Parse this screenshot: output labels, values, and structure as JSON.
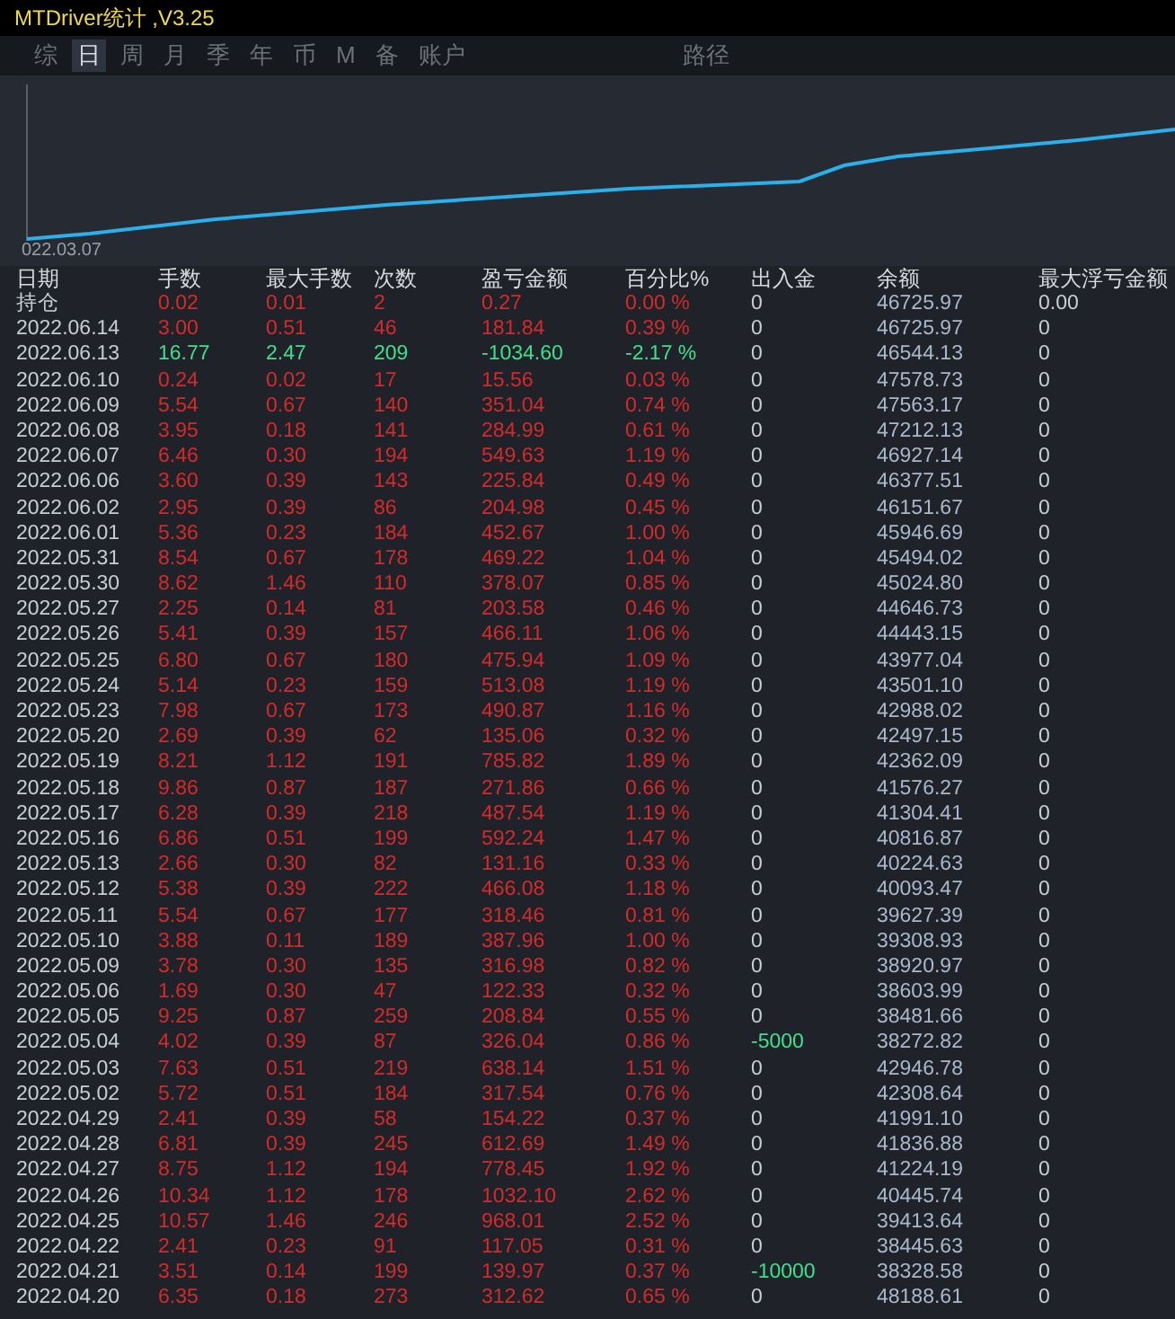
{
  "window": {
    "title": "MTDriver统计 ,V3.25"
  },
  "tabs": [
    {
      "label": "综",
      "selected": false
    },
    {
      "label": "日",
      "selected": true
    },
    {
      "label": "周",
      "selected": false
    },
    {
      "label": "月",
      "selected": false
    },
    {
      "label": "季",
      "selected": false
    },
    {
      "label": "年",
      "selected": false
    },
    {
      "label": "币",
      "selected": false
    },
    {
      "label": "M",
      "selected": false
    },
    {
      "label": "备",
      "selected": false
    },
    {
      "label": "账户",
      "selected": false
    }
  ],
  "path_tab": {
    "label": "路径",
    "selected": false
  },
  "chart": {
    "start_label": "022.03.07"
  },
  "table": {
    "columns": [
      "日期",
      "手数",
      "最大手数",
      "次数",
      "盈亏金额",
      "百分比%",
      "出入金",
      "余额",
      "最大浮亏金额"
    ],
    "rows": [
      {
        "cells": [
          "持仓",
          "0.02",
          "0.01",
          "2",
          "0.27",
          "0.00 %",
          "0",
          "46725.97",
          "0.00"
        ],
        "loss": false,
        "deposit_highlight": false
      },
      {
        "cells": [
          "2022.06.14",
          "3.00",
          "0.51",
          "46",
          "181.84",
          "0.39 %",
          "0",
          "46725.97",
          "0"
        ],
        "loss": false,
        "deposit_highlight": false
      },
      {
        "cells": [
          "2022.06.13",
          "16.77",
          "2.47",
          "209",
          "-1034.60",
          "-2.17 %",
          "0",
          "46544.13",
          "0"
        ],
        "loss": true,
        "deposit_highlight": false
      },
      {
        "cells": [
          "2022.06.10",
          "0.24",
          "0.02",
          "17",
          "15.56",
          "0.03 %",
          "0",
          "47578.73",
          "0"
        ],
        "loss": false,
        "deposit_highlight": false
      },
      {
        "cells": [
          "2022.06.09",
          "5.54",
          "0.67",
          "140",
          "351.04",
          "0.74 %",
          "0",
          "47563.17",
          "0"
        ],
        "loss": false,
        "deposit_highlight": false
      },
      {
        "cells": [
          "2022.06.08",
          "3.95",
          "0.18",
          "141",
          "284.99",
          "0.61 %",
          "0",
          "47212.13",
          "0"
        ],
        "loss": false,
        "deposit_highlight": false
      },
      {
        "cells": [
          "2022.06.07",
          "6.46",
          "0.30",
          "194",
          "549.63",
          "1.19 %",
          "0",
          "46927.14",
          "0"
        ],
        "loss": false,
        "deposit_highlight": false
      },
      {
        "cells": [
          "2022.06.06",
          "3.60",
          "0.39",
          "143",
          "225.84",
          "0.49 %",
          "0",
          "46377.51",
          "0"
        ],
        "loss": false,
        "deposit_highlight": false
      },
      {
        "cells": [
          "2022.06.02",
          "2.95",
          "0.39",
          "86",
          "204.98",
          "0.45 %",
          "0",
          "46151.67",
          "0"
        ],
        "loss": false,
        "deposit_highlight": false
      },
      {
        "cells": [
          "2022.06.01",
          "5.36",
          "0.23",
          "184",
          "452.67",
          "1.00 %",
          "0",
          "45946.69",
          "0"
        ],
        "loss": false,
        "deposit_highlight": false
      },
      {
        "cells": [
          "2022.05.31",
          "8.54",
          "0.67",
          "178",
          "469.22",
          "1.04 %",
          "0",
          "45494.02",
          "0"
        ],
        "loss": false,
        "deposit_highlight": false
      },
      {
        "cells": [
          "2022.05.30",
          "8.62",
          "1.46",
          "110",
          "378.07",
          "0.85 %",
          "0",
          "45024.80",
          "0"
        ],
        "loss": false,
        "deposit_highlight": false
      },
      {
        "cells": [
          "2022.05.27",
          "2.25",
          "0.14",
          "81",
          "203.58",
          "0.46 %",
          "0",
          "44646.73",
          "0"
        ],
        "loss": false,
        "deposit_highlight": false
      },
      {
        "cells": [
          "2022.05.26",
          "5.41",
          "0.39",
          "157",
          "466.11",
          "1.06 %",
          "0",
          "44443.15",
          "0"
        ],
        "loss": false,
        "deposit_highlight": false
      },
      {
        "cells": [
          "2022.05.25",
          "6.80",
          "0.67",
          "180",
          "475.94",
          "1.09 %",
          "0",
          "43977.04",
          "0"
        ],
        "loss": false,
        "deposit_highlight": false
      },
      {
        "cells": [
          "2022.05.24",
          "5.14",
          "0.23",
          "159",
          "513.08",
          "1.19 %",
          "0",
          "43501.10",
          "0"
        ],
        "loss": false,
        "deposit_highlight": false
      },
      {
        "cells": [
          "2022.05.23",
          "7.98",
          "0.67",
          "173",
          "490.87",
          "1.16 %",
          "0",
          "42988.02",
          "0"
        ],
        "loss": false,
        "deposit_highlight": false
      },
      {
        "cells": [
          "2022.05.20",
          "2.69",
          "0.39",
          "62",
          "135.06",
          "0.32 %",
          "0",
          "42497.15",
          "0"
        ],
        "loss": false,
        "deposit_highlight": false
      },
      {
        "cells": [
          "2022.05.19",
          "8.21",
          "1.12",
          "191",
          "785.82",
          "1.89 %",
          "0",
          "42362.09",
          "0"
        ],
        "loss": false,
        "deposit_highlight": false
      },
      {
        "cells": [
          "2022.05.18",
          "9.86",
          "0.87",
          "187",
          "271.86",
          "0.66 %",
          "0",
          "41576.27",
          "0"
        ],
        "loss": false,
        "deposit_highlight": false
      },
      {
        "cells": [
          "2022.05.17",
          "6.28",
          "0.39",
          "218",
          "487.54",
          "1.19 %",
          "0",
          "41304.41",
          "0"
        ],
        "loss": false,
        "deposit_highlight": false
      },
      {
        "cells": [
          "2022.05.16",
          "6.86",
          "0.51",
          "199",
          "592.24",
          "1.47 %",
          "0",
          "40816.87",
          "0"
        ],
        "loss": false,
        "deposit_highlight": false
      },
      {
        "cells": [
          "2022.05.13",
          "2.66",
          "0.30",
          "82",
          "131.16",
          "0.33 %",
          "0",
          "40224.63",
          "0"
        ],
        "loss": false,
        "deposit_highlight": false
      },
      {
        "cells": [
          "2022.05.12",
          "5.38",
          "0.39",
          "222",
          "466.08",
          "1.18 %",
          "0",
          "40093.47",
          "0"
        ],
        "loss": false,
        "deposit_highlight": false
      },
      {
        "cells": [
          "2022.05.11",
          "5.54",
          "0.67",
          "177",
          "318.46",
          "0.81 %",
          "0",
          "39627.39",
          "0"
        ],
        "loss": false,
        "deposit_highlight": false
      },
      {
        "cells": [
          "2022.05.10",
          "3.88",
          "0.11",
          "189",
          "387.96",
          "1.00 %",
          "0",
          "39308.93",
          "0"
        ],
        "loss": false,
        "deposit_highlight": false
      },
      {
        "cells": [
          "2022.05.09",
          "3.78",
          "0.30",
          "135",
          "316.98",
          "0.82 %",
          "0",
          "38920.97",
          "0"
        ],
        "loss": false,
        "deposit_highlight": false
      },
      {
        "cells": [
          "2022.05.06",
          "1.69",
          "0.30",
          "47",
          "122.33",
          "0.32 %",
          "0",
          "38603.99",
          "0"
        ],
        "loss": false,
        "deposit_highlight": false
      },
      {
        "cells": [
          "2022.05.05",
          "9.25",
          "0.87",
          "259",
          "208.84",
          "0.55 %",
          "0",
          "38481.66",
          "0"
        ],
        "loss": false,
        "deposit_highlight": false
      },
      {
        "cells": [
          "2022.05.04",
          "4.02",
          "0.39",
          "87",
          "326.04",
          "0.86 %",
          "-5000",
          "38272.82",
          "0"
        ],
        "loss": false,
        "deposit_highlight": true
      },
      {
        "cells": [
          "2022.05.03",
          "7.63",
          "0.51",
          "219",
          "638.14",
          "1.51 %",
          "0",
          "42946.78",
          "0"
        ],
        "loss": false,
        "deposit_highlight": false
      },
      {
        "cells": [
          "2022.05.02",
          "5.72",
          "0.51",
          "184",
          "317.54",
          "0.76 %",
          "0",
          "42308.64",
          "0"
        ],
        "loss": false,
        "deposit_highlight": false
      },
      {
        "cells": [
          "2022.04.29",
          "2.41",
          "0.39",
          "58",
          "154.22",
          "0.37 %",
          "0",
          "41991.10",
          "0"
        ],
        "loss": false,
        "deposit_highlight": false
      },
      {
        "cells": [
          "2022.04.28",
          "6.81",
          "0.39",
          "245",
          "612.69",
          "1.49 %",
          "0",
          "41836.88",
          "0"
        ],
        "loss": false,
        "deposit_highlight": false
      },
      {
        "cells": [
          "2022.04.27",
          "8.75",
          "1.12",
          "194",
          "778.45",
          "1.92 %",
          "0",
          "41224.19",
          "0"
        ],
        "loss": false,
        "deposit_highlight": false
      },
      {
        "cells": [
          "2022.04.26",
          "10.34",
          "1.12",
          "178",
          "1032.10",
          "2.62 %",
          "0",
          "40445.74",
          "0"
        ],
        "loss": false,
        "deposit_highlight": false
      },
      {
        "cells": [
          "2022.04.25",
          "10.57",
          "1.46",
          "246",
          "968.01",
          "2.52 %",
          "0",
          "39413.64",
          "0"
        ],
        "loss": false,
        "deposit_highlight": false
      },
      {
        "cells": [
          "2022.04.22",
          "2.41",
          "0.23",
          "91",
          "117.05",
          "0.31 %",
          "0",
          "38445.63",
          "0"
        ],
        "loss": false,
        "deposit_highlight": false
      },
      {
        "cells": [
          "2022.04.21",
          "3.51",
          "0.14",
          "199",
          "139.97",
          "0.37 %",
          "-10000",
          "38328.58",
          "0"
        ],
        "loss": false,
        "deposit_highlight": true
      },
      {
        "cells": [
          "2022.04.20",
          "6.35",
          "0.18",
          "273",
          "312.62",
          "0.65 %",
          "0",
          "48188.61",
          "0"
        ],
        "loss": false,
        "deposit_highlight": false
      }
    ]
  }
}
